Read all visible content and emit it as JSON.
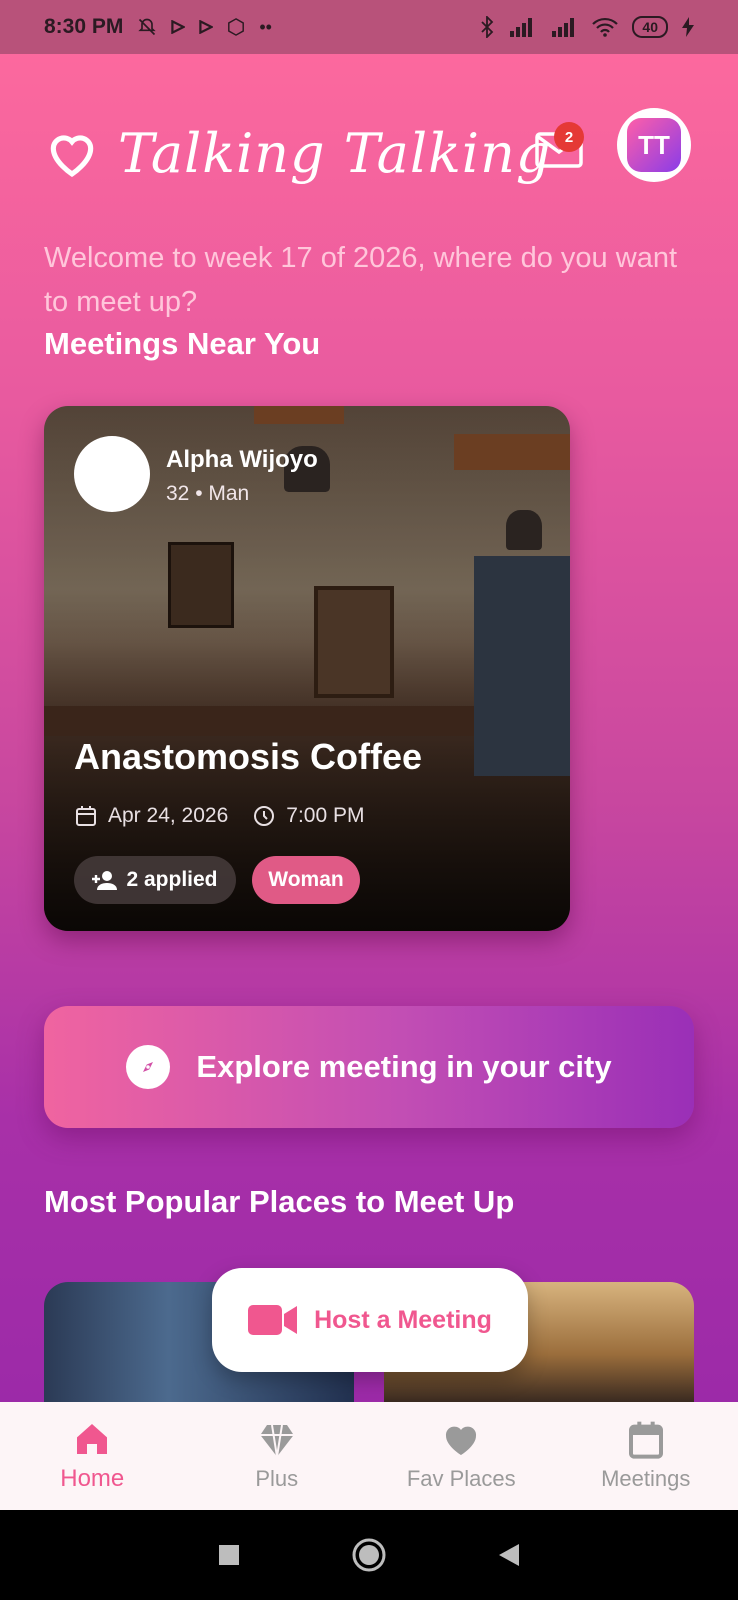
{
  "status_bar": {
    "time": "8:30 PM",
    "left_icons": [
      "bell-off-icon",
      "play-icon",
      "play-icon",
      "mi-icon",
      "more-dots-icon"
    ],
    "right_icons": [
      "bluetooth-icon",
      "signal-icon",
      "signal-icon",
      "wifi-icon",
      "battery-icon",
      "charging-icon"
    ],
    "battery": "40"
  },
  "header": {
    "title": "Talking Talking",
    "mail_badge": "2",
    "avatar_text": "TT"
  },
  "welcome_text": "Welcome to week 17 of 2026, where do you want to meet up?",
  "sections": {
    "near": "Meetings Near You",
    "popular": "Most Popular Places to Meet Up"
  },
  "meeting_card": {
    "host_name": "Alpha Wijoyo",
    "host_meta": "32 • Man",
    "place_name": "Anastomosis Coffee",
    "date": "Apr 24, 2026",
    "time": "7:00 PM",
    "applied": "2 applied",
    "gender_tag": "Woman"
  },
  "explore_button": {
    "label": "Explore meeting in your city"
  },
  "host_fab": {
    "label": "Host a Meeting"
  },
  "bottom_nav": [
    {
      "label": "Home",
      "icon": "home-icon",
      "active": true
    },
    {
      "label": "Plus",
      "icon": "diamond-icon",
      "active": false
    },
    {
      "label": "Fav Places",
      "icon": "heart-icon",
      "active": false
    },
    {
      "label": "Meetings",
      "icon": "calendar-icon",
      "active": false
    }
  ],
  "colors": {
    "accent": "#f0578f",
    "gradient_top": "#ff6b9e",
    "gradient_bottom": "#9426a8",
    "badge": "#e53935"
  }
}
